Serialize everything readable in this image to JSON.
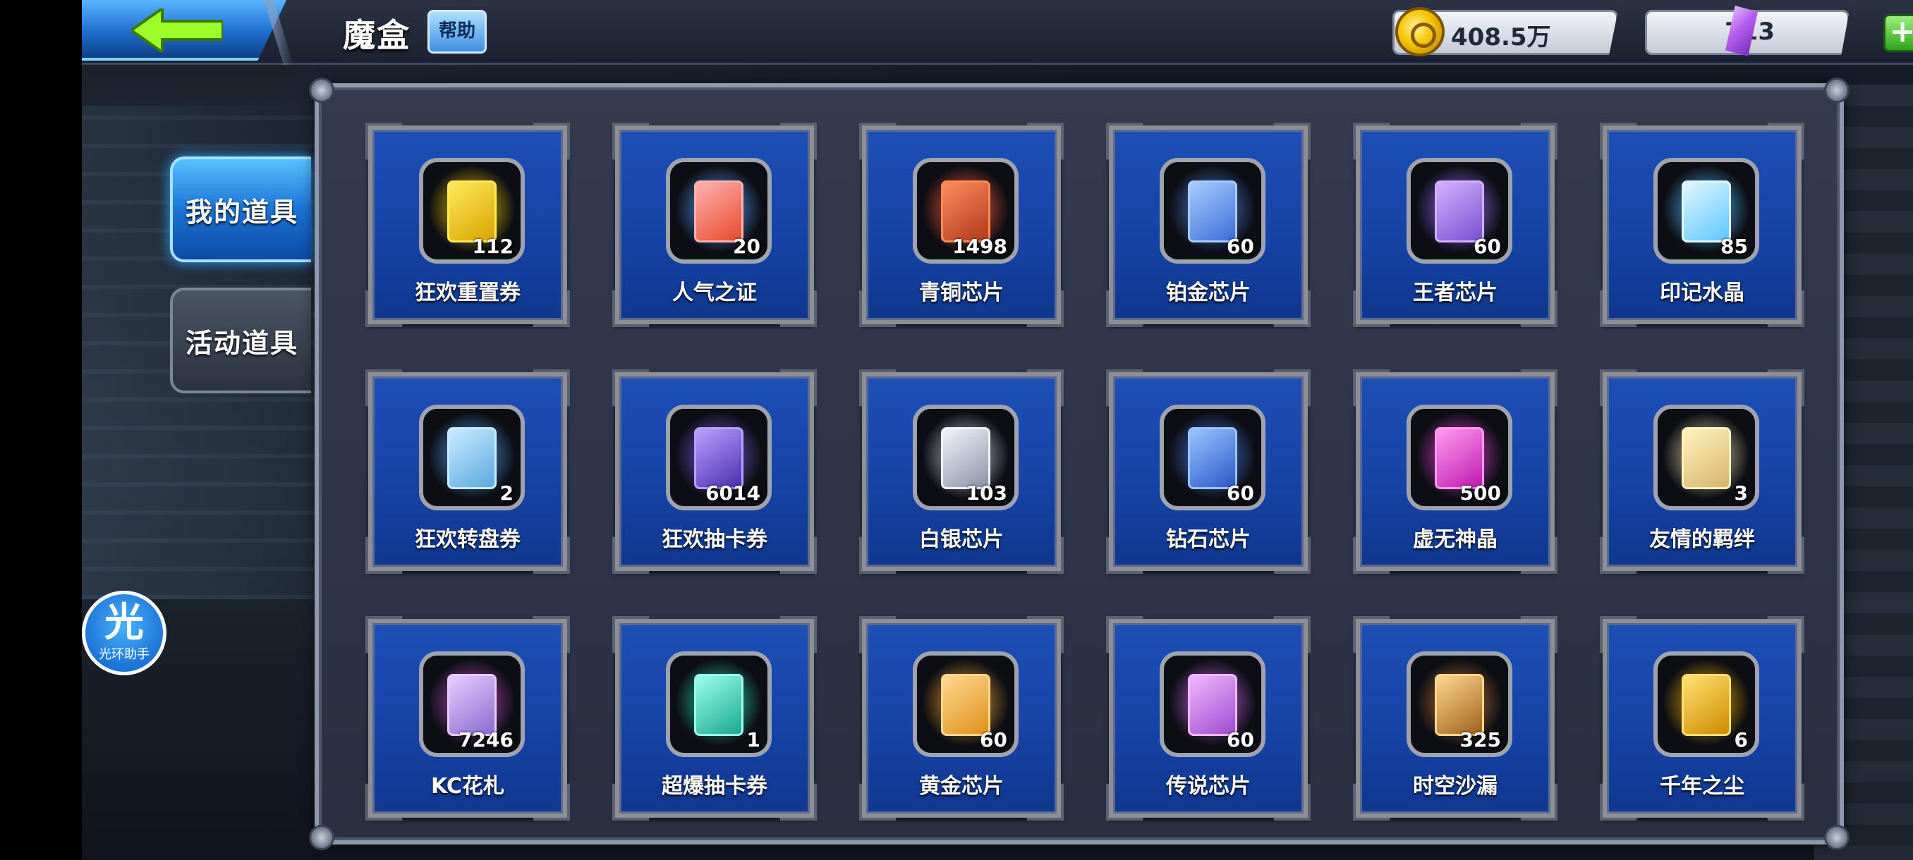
{
  "header": {
    "title": "魔盒",
    "help_label": "帮助",
    "back_icon": "back-arrow-icon"
  },
  "currency": {
    "gold": {
      "value": "408.5万",
      "icon": "gold-coin-icon",
      "add": "+"
    },
    "gem": {
      "value": "713",
      "icon": "purple-crystal-icon",
      "add": "+"
    }
  },
  "tabs": [
    {
      "label": "我的道具",
      "active": true
    },
    {
      "label": "活动道具",
      "active": false
    }
  ],
  "assistant": {
    "glyph": "光",
    "label": "光环助手"
  },
  "colors": {
    "tab_active": "#1b74d6",
    "card_bg": "#1542a4",
    "panel_bg": "#2a3042"
  },
  "items": [
    {
      "name": "狂欢重置券",
      "count": "112",
      "icon": "reset-ticket-icon",
      "art": [
        "#ffe85a",
        "#d9a400"
      ],
      "glow": "#f2c800"
    },
    {
      "name": "人气之证",
      "count": "20",
      "icon": "popularity-card-icon",
      "art": [
        "#ffb1b1",
        "#e74a2a"
      ],
      "glow": "#5aa0ff"
    },
    {
      "name": "青铜芯片",
      "count": "1498",
      "icon": "bronze-chip-icon",
      "art": [
        "#ff8a5a",
        "#b03a1a"
      ],
      "glow": "#ff5a3a"
    },
    {
      "name": "铂金芯片",
      "count": "60",
      "icon": "platinum-chip-icon",
      "art": [
        "#a8ccff",
        "#3a6fd8"
      ],
      "glow": "#4f7fd8"
    },
    {
      "name": "王者芯片",
      "count": "60",
      "icon": "king-chip-icon",
      "art": [
        "#d4b0ff",
        "#7a4fd0"
      ],
      "glow": "#9a6aff"
    },
    {
      "name": "印记水晶",
      "count": "85",
      "icon": "seal-crystal-icon",
      "art": [
        "#e2f6ff",
        "#5ac8ff"
      ],
      "glow": "#4fb8ff"
    },
    {
      "name": "狂欢转盘券",
      "count": "2",
      "icon": "wheel-ticket-icon",
      "art": [
        "#c8ecff",
        "#5aa8e0"
      ],
      "glow": "#4fa0e0"
    },
    {
      "name": "狂欢抽卡券",
      "count": "6014",
      "icon": "draw-ticket-icon",
      "art": [
        "#b8a0ff",
        "#4a2fb0"
      ],
      "glow": "#7a5ae0"
    },
    {
      "name": "白银芯片",
      "count": "103",
      "icon": "silver-chip-icon",
      "art": [
        "#f0f3f8",
        "#8a93a8"
      ],
      "glow": "#c0c8d8"
    },
    {
      "name": "钻石芯片",
      "count": "60",
      "icon": "diamond-chip-icon",
      "art": [
        "#9ac4ff",
        "#2a58c8"
      ],
      "glow": "#4a7ae0"
    },
    {
      "name": "虚无神晶",
      "count": "500",
      "icon": "void-crystal-icon",
      "art": [
        "#ff9af0",
        "#c01ab0"
      ],
      "glow": "#e03ad0"
    },
    {
      "name": "友情的羁绊",
      "count": "3",
      "icon": "friendship-bond-icon",
      "art": [
        "#fff4c0",
        "#d8b46a"
      ],
      "glow": "#e0d0a0"
    },
    {
      "name": "KC花札",
      "count": "7246",
      "icon": "kc-card-icon",
      "art": [
        "#e8ccff",
        "#8a6ad0"
      ],
      "glow": "#c04ac0"
    },
    {
      "name": "超爆抽卡券",
      "count": "1",
      "icon": "super-draw-ticket-icon",
      "art": [
        "#9affec",
        "#1aa890"
      ],
      "glow": "#2ad0b0"
    },
    {
      "name": "黄金芯片",
      "count": "60",
      "icon": "gold-chip-icon",
      "art": [
        "#ffd890",
        "#e0901a"
      ],
      "glow": "#f0a030"
    },
    {
      "name": "传说芯片",
      "count": "60",
      "icon": "legend-chip-icon",
      "art": [
        "#f0b8ff",
        "#a04ad0"
      ],
      "glow": "#c060e0"
    },
    {
      "name": "时空沙漏",
      "count": "325",
      "icon": "hourglass-icon",
      "art": [
        "#ffd890",
        "#a0601a"
      ],
      "glow": "#c07030"
    },
    {
      "name": "千年之尘",
      "count": "6",
      "icon": "millennium-dust-icon",
      "art": [
        "#ffe070",
        "#d08a00"
      ],
      "glow": "#f0a800"
    }
  ]
}
